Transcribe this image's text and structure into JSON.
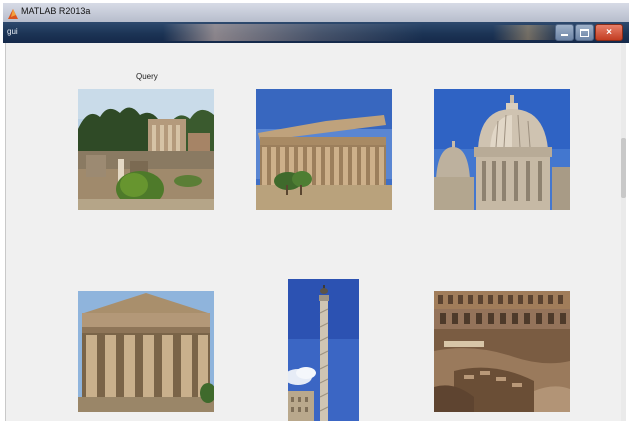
{
  "window": {
    "title": "MATLAB R2013a"
  },
  "figure": {
    "title": "gui"
  },
  "query": {
    "label": "Query"
  },
  "images": [
    {
      "name": "roman-forum-ruins"
    },
    {
      "name": "greek-temple-side-view"
    },
    {
      "name": "st-peters-dome"
    },
    {
      "name": "greek-temple-front-view"
    },
    {
      "name": "trajans-column"
    },
    {
      "name": "colosseum-interior"
    }
  ]
}
